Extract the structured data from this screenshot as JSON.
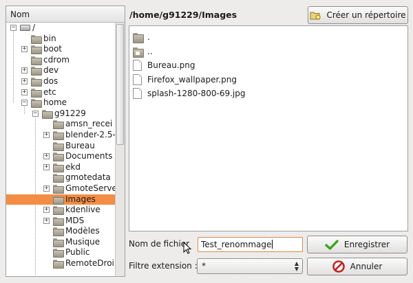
{
  "tree": {
    "header": "Nom",
    "rows": [
      {
        "label": "/",
        "depth": 0,
        "expander": "-",
        "icon": "drive"
      },
      {
        "label": "bin",
        "depth": 1,
        "expander": "",
        "icon": "folder"
      },
      {
        "label": "boot",
        "depth": 1,
        "expander": "+",
        "icon": "folder"
      },
      {
        "label": "cdrom",
        "depth": 1,
        "expander": "",
        "icon": "folder"
      },
      {
        "label": "dev",
        "depth": 1,
        "expander": "+",
        "icon": "folder"
      },
      {
        "label": "dos",
        "depth": 1,
        "expander": "+",
        "icon": "folder"
      },
      {
        "label": "etc",
        "depth": 1,
        "expander": "+",
        "icon": "folder"
      },
      {
        "label": "home",
        "depth": 1,
        "expander": "-",
        "icon": "folder"
      },
      {
        "label": "g91229",
        "depth": 2,
        "expander": "-",
        "icon": "folder"
      },
      {
        "label": "amsn_recei",
        "depth": 3,
        "expander": "",
        "icon": "folder"
      },
      {
        "label": "blender-2.5-",
        "depth": 3,
        "expander": "+",
        "icon": "folder"
      },
      {
        "label": "Bureau",
        "depth": 3,
        "expander": "",
        "icon": "folder"
      },
      {
        "label": "Documents",
        "depth": 3,
        "expander": "+",
        "icon": "folder"
      },
      {
        "label": "ekd",
        "depth": 3,
        "expander": "+",
        "icon": "folder"
      },
      {
        "label": "gmotedata",
        "depth": 3,
        "expander": "",
        "icon": "folder"
      },
      {
        "label": "GmoteServe",
        "depth": 3,
        "expander": "+",
        "icon": "folder"
      },
      {
        "label": "Images",
        "depth": 3,
        "expander": "",
        "icon": "folder",
        "selected": true
      },
      {
        "label": "kdenlive",
        "depth": 3,
        "expander": "+",
        "icon": "folder"
      },
      {
        "label": "MDS",
        "depth": 3,
        "expander": "+",
        "icon": "folder"
      },
      {
        "label": "Modèles",
        "depth": 3,
        "expander": "",
        "icon": "folder"
      },
      {
        "label": "Musique",
        "depth": 3,
        "expander": "",
        "icon": "folder"
      },
      {
        "label": "Public",
        "depth": 3,
        "expander": "",
        "icon": "folder"
      },
      {
        "label": "RemoteDroi",
        "depth": 3,
        "expander": "",
        "icon": "folder"
      }
    ]
  },
  "path_title": "/home/g91229/Images",
  "create_button": {
    "label": "Créer un répertoire",
    "icon": "new-folder-icon"
  },
  "files": [
    {
      "name": ".",
      "icon": "folder"
    },
    {
      "name": "..",
      "icon": "home-folder"
    },
    {
      "name": "Bureau.png",
      "icon": "file"
    },
    {
      "name": "Firefox_wallpaper.png",
      "icon": "file"
    },
    {
      "name": "splash-1280-800-69.jpg",
      "icon": "file"
    }
  ],
  "filename": {
    "label": "Nom de fichier",
    "value": "Test_renommage"
  },
  "filter": {
    "label": "Filtre extension :",
    "value": "*"
  },
  "save_button": {
    "label": "Enregistrer",
    "icon": "checkmark-icon"
  },
  "cancel_button": {
    "label": "Annuler",
    "icon": "cancel-icon"
  },
  "colors": {
    "selection": "#f38d45",
    "save_check": "#3aa51c",
    "cancel_red": "#c3211f"
  }
}
